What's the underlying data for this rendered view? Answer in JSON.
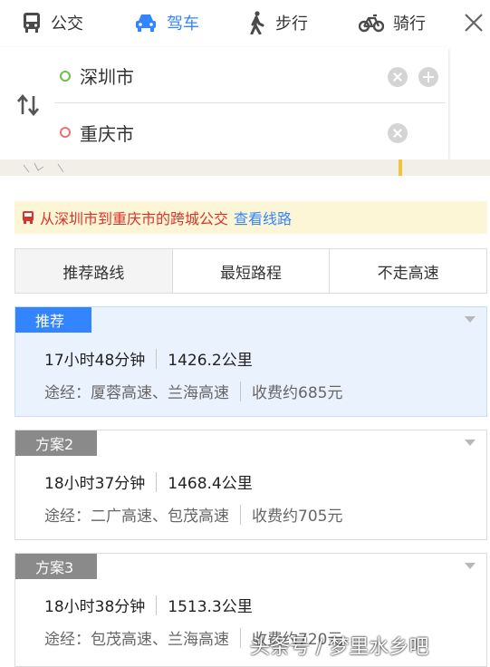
{
  "modes": [
    {
      "label": "公交",
      "icon": "bus-icon"
    },
    {
      "label": "驾车",
      "icon": "car-icon",
      "active": true
    },
    {
      "label": "步行",
      "icon": "walk-icon"
    },
    {
      "label": "骑行",
      "icon": "bike-icon"
    }
  ],
  "route": {
    "start": "深圳市",
    "end": "重庆市"
  },
  "notice": {
    "text": "从深圳市到重庆市的跨城公交",
    "link": "查看线路"
  },
  "strategy": {
    "tabs": [
      "推荐路线",
      "最短路程",
      "不走高速"
    ],
    "active_index": 0
  },
  "plans": [
    {
      "badge": "推荐",
      "duration": "17小时48分钟",
      "distance": "1426.2公里",
      "via": "途经：厦蓉高速、兰海高速",
      "toll": "收费约685元"
    },
    {
      "badge": "方案2",
      "duration": "18小时37分钟",
      "distance": "1468.4公里",
      "via": "途经：二广高速、包茂高速",
      "toll": "收费约705元"
    },
    {
      "badge": "方案3",
      "duration": "18小时38分钟",
      "distance": "1513.3公里",
      "via": "途经：包茂高速、兰海高速",
      "toll": "收费约720元"
    }
  ],
  "watermark": "头条号 / 梦里水乡吧",
  "colors": {
    "accent": "#3385ff",
    "notice_text": "#d9342b",
    "notice_bg": "#fdf6d6",
    "selected_card_bg": "#eaf2fd"
  }
}
